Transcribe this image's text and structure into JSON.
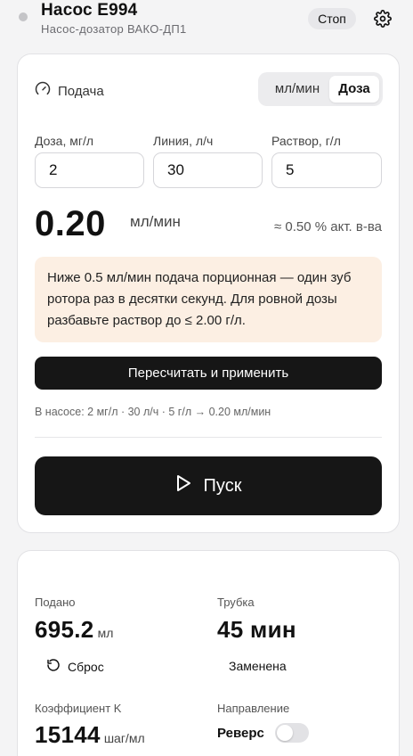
{
  "header": {
    "title": "Насос E994",
    "subtitle": "Насос-дозатор ВАКО-ДП1",
    "stop_label": "Стоп"
  },
  "feed": {
    "label": "Подача",
    "mode_options": [
      "мл/мин",
      "Доза"
    ],
    "mode_selected": "Доза",
    "fields": [
      {
        "label": "Доза, мг/л",
        "value": "2"
      },
      {
        "label": "Линия, л/ч",
        "value": "30"
      },
      {
        "label": "Раствор, г/л",
        "value": "5"
      }
    ],
    "result_value": "0.20",
    "result_unit": "мл/мин",
    "concentration": "≈ 0.50 % акт. в-ва",
    "note": "Ниже 0.5 мл/мин подача порционная — один зуб ротора раз в десятки секунд. Для ровной дозы разбавьте раствор до ≤ 2.00 г/л.",
    "recalc_label": "Пересчитать и применить",
    "summary": "В насосе: 2 мг/л · 30 л/ч · 5 г/л → 0.20 мл/мин",
    "start_label": "Пуск"
  },
  "stats": {
    "delivered_label": "Подано",
    "delivered_value": "695.2",
    "delivered_unit": "мл",
    "reset_label": "Сброс",
    "tube_label": "Трубка",
    "tube_value": "45 мин",
    "tube_status": "Заменена",
    "coef_label": "Коэффициент K",
    "coef_value": "15144",
    "coef_unit": "шаг/мл",
    "direction_label": "Направление",
    "reverse_label": "Реверс",
    "reverse_on": false
  },
  "colors": {
    "accent_dark": "#161616",
    "note_bg": "#fcefe3",
    "status_dot": "#c4c4c7"
  }
}
